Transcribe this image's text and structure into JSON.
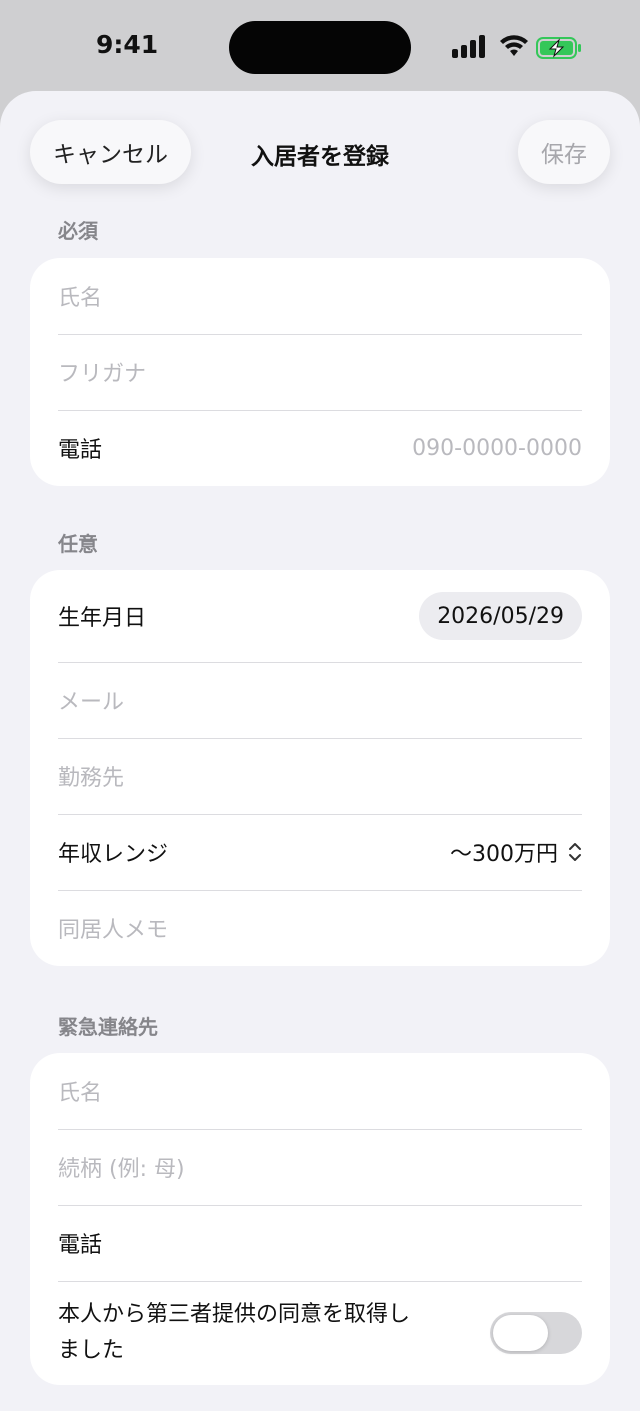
{
  "status_bar": {
    "time": "9:41"
  },
  "header": {
    "cancel_label": "キャンセル",
    "title": "入居者を登録",
    "save_label": "保存"
  },
  "required": {
    "label": "必須",
    "name_placeholder": "氏名",
    "kana_placeholder": "フリガナ",
    "phone_label": "電話",
    "phone_placeholder": "090-0000-0000"
  },
  "optional": {
    "label": "任意",
    "birthday_label": "生年月日",
    "birthday_value": "2026/05/29",
    "email_placeholder": "メール",
    "workplace_placeholder": "勤務先",
    "income_label": "年収レンジ",
    "income_value": "〜300万円",
    "cohabitant_placeholder": "同居人メモ"
  },
  "emergency": {
    "label": "緊急連絡先",
    "name_placeholder": "氏名",
    "relation_placeholder": "続柄 (例: 母)",
    "phone_label": "電話",
    "consent_label": "本人から第三者提供の同意を取得しました",
    "consent_on": false
  },
  "colors": {
    "battery_green": "#34c759",
    "accent_gray": "#86868b"
  },
  "icons": [
    "cellular-signal-icon",
    "wifi-icon",
    "battery-charging-icon",
    "chevron-up-down-icon"
  ]
}
